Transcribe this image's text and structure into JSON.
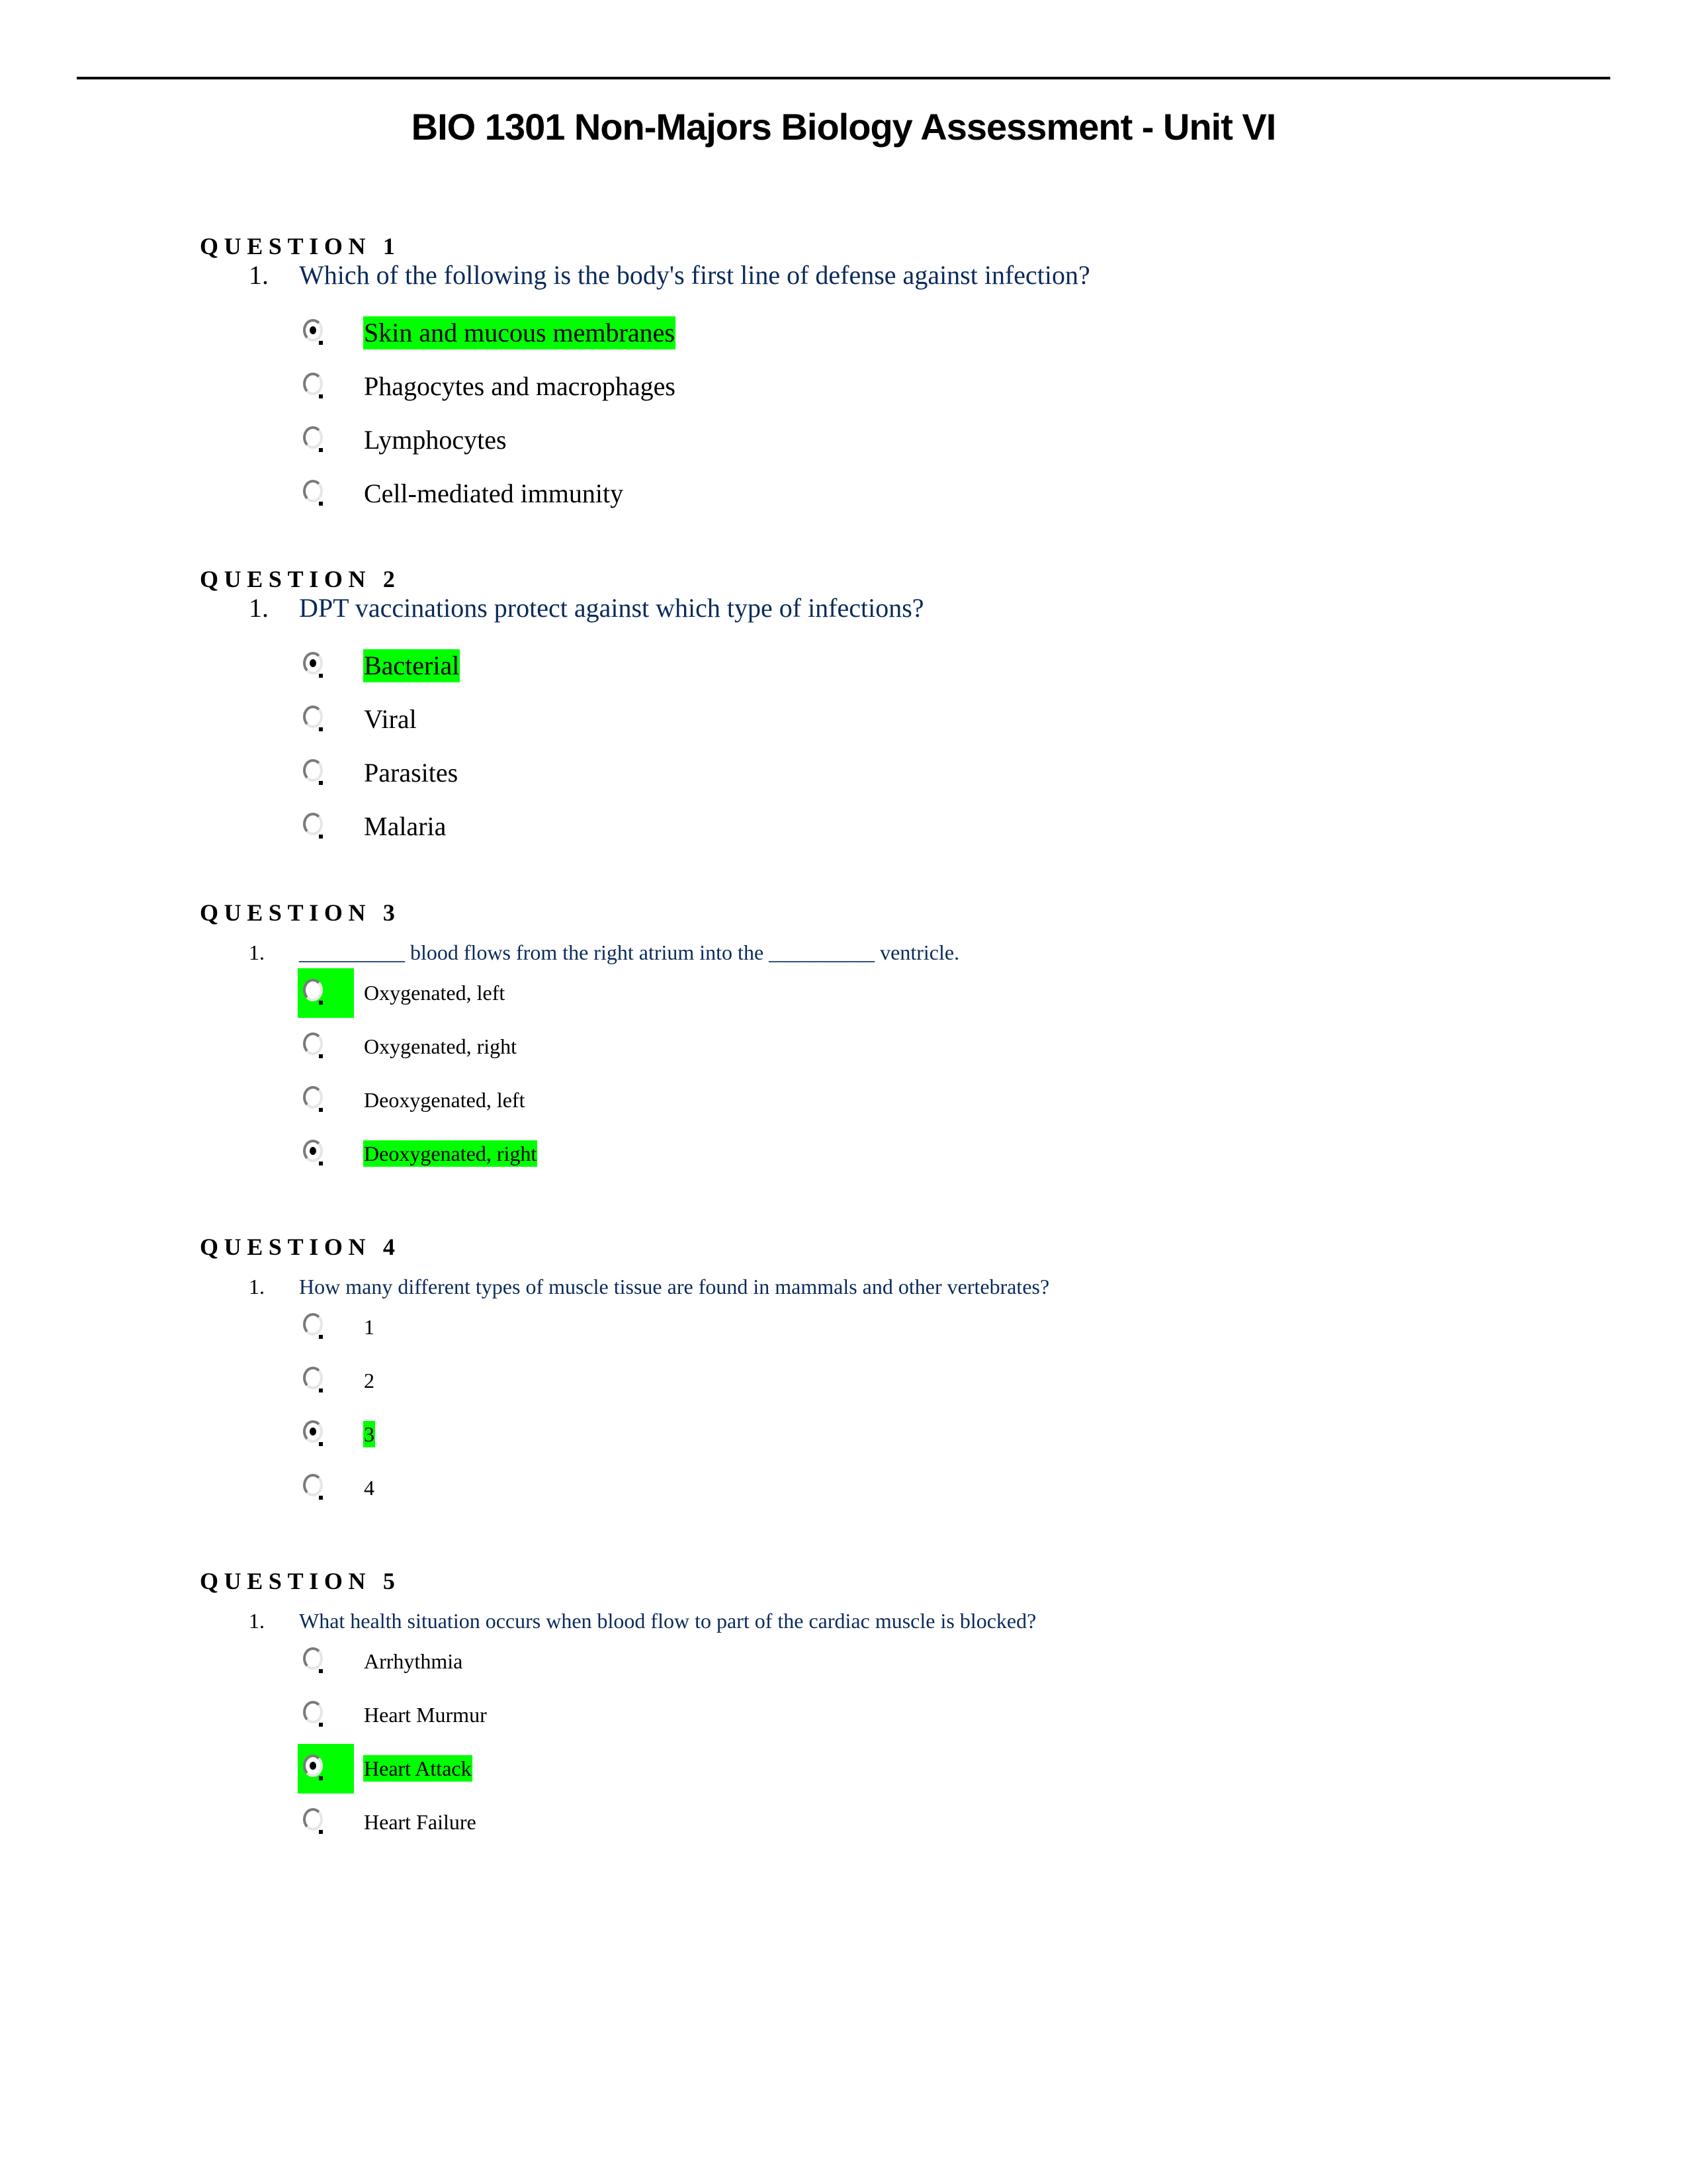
{
  "document": {
    "title": "BIO 1301 Non-Majors Biology Assessment - Unit VI"
  },
  "colors": {
    "question_text": "#0b2a5b",
    "highlight": "#00ff00"
  },
  "questions": [
    {
      "heading": "QUESTION 1",
      "number": "1.",
      "text": "Which of the following is the body's first line of defense against infection?",
      "options": [
        {
          "label": "Skin and mucous membranes",
          "selected": true,
          "text_highlighted": true,
          "radio_highlighted": false
        },
        {
          "label": "Phagocytes and macrophages",
          "selected": false,
          "text_highlighted": false,
          "radio_highlighted": false
        },
        {
          "label": "Lymphocytes",
          "selected": false,
          "text_highlighted": false,
          "radio_highlighted": false
        },
        {
          "label": "Cell-mediated immunity",
          "selected": false,
          "text_highlighted": false,
          "radio_highlighted": false
        }
      ]
    },
    {
      "heading": "QUESTION 2",
      "number": "1.",
      "text": "DPT vaccinations protect against which type of infections?",
      "options": [
        {
          "label": "Bacterial",
          "selected": true,
          "text_highlighted": true,
          "radio_highlighted": false
        },
        {
          "label": "Viral",
          "selected": false,
          "text_highlighted": false,
          "radio_highlighted": false
        },
        {
          "label": "Parasites",
          "selected": false,
          "text_highlighted": false,
          "radio_highlighted": false
        },
        {
          "label": "Malaria",
          "selected": false,
          "text_highlighted": false,
          "radio_highlighted": false
        }
      ]
    },
    {
      "heading": "QUESTION 3",
      "number": "1.",
      "text": "__________ blood flows from the right atrium into the __________ ventricle.",
      "options": [
        {
          "label": "Oxygenated, left",
          "selected": false,
          "text_highlighted": false,
          "radio_highlighted": true
        },
        {
          "label": "Oxygenated, right",
          "selected": false,
          "text_highlighted": false,
          "radio_highlighted": false
        },
        {
          "label": "Deoxygenated, left",
          "selected": false,
          "text_highlighted": false,
          "radio_highlighted": false
        },
        {
          "label": "Deoxygenated, right",
          "selected": true,
          "text_highlighted": true,
          "radio_highlighted": false
        }
      ]
    },
    {
      "heading": "QUESTION 4",
      "number": "1.",
      "text": "How many different types of muscle tissue are found in mammals and other vertebrates?",
      "options": [
        {
          "label": "1",
          "selected": false,
          "text_highlighted": false,
          "radio_highlighted": false
        },
        {
          "label": "2",
          "selected": false,
          "text_highlighted": false,
          "radio_highlighted": false
        },
        {
          "label": "3",
          "selected": true,
          "text_highlighted": true,
          "radio_highlighted": false
        },
        {
          "label": "4",
          "selected": false,
          "text_highlighted": false,
          "radio_highlighted": false
        }
      ]
    },
    {
      "heading": "QUESTION 5",
      "number": "1.",
      "text": "What health situation occurs when blood flow to part of the cardiac muscle is blocked?",
      "options": [
        {
          "label": "Arrhythmia",
          "selected": false,
          "text_highlighted": false,
          "radio_highlighted": false
        },
        {
          "label": "Heart Murmur",
          "selected": false,
          "text_highlighted": false,
          "radio_highlighted": false
        },
        {
          "label": "Heart Attack",
          "selected": true,
          "text_highlighted": true,
          "radio_highlighted": true
        },
        {
          "label": "Heart Failure",
          "selected": false,
          "text_highlighted": false,
          "radio_highlighted": false
        }
      ]
    }
  ]
}
